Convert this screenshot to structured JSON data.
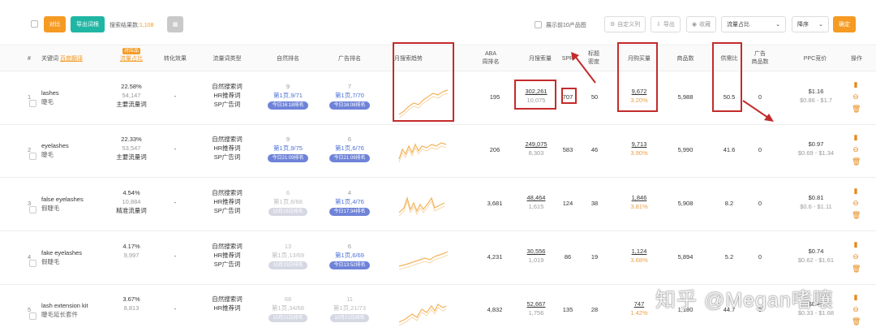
{
  "toolbar": {
    "compare_label": "对比",
    "export_label": "导出词根",
    "search_count_prefix": "搜索结果数:",
    "search_count": "1,108",
    "show_top10_label": "展示前10产品图",
    "custom_cols_label": "自定义列",
    "export2_label": "导出",
    "favorite_label": "收藏",
    "sort_field": "流量占比",
    "sort_order": "降序",
    "confirm_label": "确定"
  },
  "headers": {
    "no": "#",
    "keyword": "关键词",
    "keyword_sub": "百度翻译",
    "traffic_tag": "对应品",
    "traffic": "流量占比",
    "conversion": "转化效果",
    "kw_type": "流量词类型",
    "organic_rank": "自然排名",
    "ad_rank": "广告排名",
    "trend": "月搜索趋势",
    "aba": "ABA",
    "aba2": "周排名",
    "monthly_search": "月搜索量",
    "spr": "SPR",
    "title_density": "标题",
    "title_density2": "密度",
    "monthly_purchase": "月购买量",
    "product_count": "商品数",
    "supply_demand": "供需比",
    "ad_products": "广告",
    "ad_products2": "商品数",
    "ppc": "PPC竞价",
    "ops": "操作"
  },
  "rows": [
    {
      "no": "1",
      "kw": "lashes",
      "cn": "睫毛",
      "pct": "22.58%",
      "cnt": "54,147",
      "ttype": "主要流量词",
      "conv": "-",
      "types": [
        "自然搜索词",
        "HR推荐词",
        "SP广告词"
      ],
      "org_n": "9",
      "org_p": "第1页,9/71",
      "org_pill": "今日16:18排名",
      "ad_n": "7",
      "ad_p": "第1页,7/70",
      "ad_pill": "今日16:08排名",
      "aba": "195",
      "ms": "302,261",
      "ms2": "10,075",
      "spr": "707",
      "td": "50",
      "mp": "9,672",
      "mp2": "3.20%",
      "pc": "5,988",
      "sd": "50.5",
      "adp": "0",
      "ppc": "$1.16",
      "ppc2": "$0.86 - $1.7"
    },
    {
      "no": "2",
      "kw": "eyelashes",
      "cn": "睫毛",
      "pct": "22.33%",
      "cnt": "53,547",
      "ttype": "主要流量词",
      "conv": "-",
      "types": [
        "自然搜索词",
        "HR推荐词",
        "SP广告词"
      ],
      "org_n": "9",
      "org_p": "第1页,9/75",
      "org_pill": "今日21:09排名",
      "ad_n": "6",
      "ad_p": "第1页,6/76",
      "ad_pill": "今日21:09排名",
      "aba": "206",
      "ms": "249,075",
      "ms2": "8,303",
      "spr": "583",
      "td": "46",
      "mp": "9,713",
      "mp2": "3.90%",
      "pc": "5,990",
      "sd": "41.6",
      "adp": "0",
      "ppc": "$0.97",
      "ppc2": "$0.69 - $1.34"
    },
    {
      "no": "3",
      "kw": "false eyelashes",
      "cn": "假睫毛",
      "pct": "4.54%",
      "cnt": "10,884",
      "ttype": "精准流量词",
      "conv": "-",
      "types": [
        "自然搜索词",
        "HR推荐词",
        "SP广告词"
      ],
      "org_n": "6",
      "org_p": "第1页,6/68",
      "org_pill": "10月16日排名",
      "ad_n": "4",
      "ad_p": "第1页,4/76",
      "ad_pill": "今日17:34排名",
      "aba": "3,681",
      "ms": "48,464",
      "ms2": "1,615",
      "spr": "124",
      "td": "38",
      "mp": "1,846",
      "mp2": "3.81%",
      "pc": "5,908",
      "sd": "8.2",
      "adp": "0",
      "ppc": "$0.81",
      "ppc2": "$0.6 - $1.11"
    },
    {
      "no": "4",
      "kw": "fake eyelashes",
      "cn": "假睫毛",
      "pct": "4.17%",
      "cnt": "9,997",
      "ttype": "",
      "conv": "-",
      "types": [
        "自然搜索词",
        "HR推荐词",
        "SP广告词"
      ],
      "org_n": "13",
      "org_p": "第1页,13/69",
      "org_pill": "10月23日排名",
      "ad_n": "6",
      "ad_p": "第1页,6/69",
      "ad_pill": "今日13:52排名",
      "aba": "4,231",
      "ms": "30,556",
      "ms2": "1,019",
      "spr": "86",
      "td": "19",
      "mp": "1,124",
      "mp2": "3.68%",
      "pc": "5,894",
      "sd": "5.2",
      "adp": "0",
      "ppc": "$0.74",
      "ppc2": "$0.62 - $1.61"
    },
    {
      "no": "5",
      "kw": "lash extension kit",
      "cn": "睫毛延长套件",
      "pct": "3.67%",
      "cnt": "8,813",
      "ttype": "",
      "conv": "-",
      "types": [
        "自然搜索词",
        "HR推荐词"
      ],
      "org_n": "68",
      "org_p": "第1页,34/68",
      "org_pill": "10月21日排名",
      "ad_n": "11",
      "ad_p": "第1页,21/73",
      "ad_pill": "10月21日排名",
      "aba": "4,832",
      "ms": "52,667",
      "ms2": "1,756",
      "spr": "135",
      "td": "28",
      "mp": "747",
      "mp2": "1.42%",
      "pc": "1,180",
      "sd": "44.7",
      "adp": "0",
      "ppc": "$0.40",
      "ppc2": "$0.33 - $1.68"
    }
  ],
  "watermark": "知乎 @Megan嗜嚷",
  "colors": {
    "accent": "#f59a23",
    "teal": "#1fb6a4",
    "pill": "#6e83d8",
    "annotation": "#c32b2b"
  }
}
